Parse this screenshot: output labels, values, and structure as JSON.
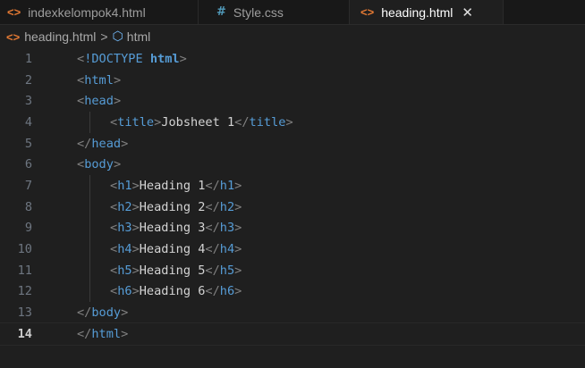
{
  "tabs": [
    {
      "icon": "<>",
      "label": "indexkelompok4.html",
      "type": "html",
      "active": false
    },
    {
      "icon": "#",
      "label": "Style.css",
      "type": "css",
      "active": false
    },
    {
      "icon": "<>",
      "label": "heading.html",
      "type": "html",
      "active": true,
      "close": "✕"
    }
  ],
  "breadcrumb": {
    "file_icon": "<>",
    "file": "heading.html",
    "separator": ">",
    "symbol_icon": "⬡",
    "symbol": "html"
  },
  "editor": {
    "current_line": 14,
    "lines": [
      {
        "n": "1",
        "parts": [
          [
            "<",
            "p"
          ],
          [
            "!DOCTYPE",
            "d"
          ],
          [
            " ",
            "txt"
          ],
          [
            "html",
            "kw"
          ],
          [
            ">",
            "p"
          ]
        ]
      },
      {
        "n": "2",
        "parts": [
          [
            "<",
            "p"
          ],
          [
            "html",
            "t"
          ],
          [
            ">",
            "p"
          ]
        ]
      },
      {
        "n": "3",
        "parts": [
          [
            "<",
            "p"
          ],
          [
            "head",
            "t"
          ],
          [
            ">",
            "p"
          ]
        ]
      },
      {
        "n": "4",
        "parts": [
          [
            "<",
            "p"
          ],
          [
            "title",
            "t"
          ],
          [
            ">",
            "p"
          ],
          [
            "Jobsheet 1",
            "txt"
          ],
          [
            "</",
            "p"
          ],
          [
            "title",
            "t"
          ],
          [
            ">",
            "p"
          ]
        ],
        "indent": true
      },
      {
        "n": "5",
        "parts": [
          [
            "</",
            "p"
          ],
          [
            "head",
            "t"
          ],
          [
            ">",
            "p"
          ]
        ]
      },
      {
        "n": "6",
        "parts": [
          [
            "<",
            "p"
          ],
          [
            "body",
            "t"
          ],
          [
            ">",
            "p"
          ]
        ]
      },
      {
        "n": "7",
        "parts": [
          [
            "<",
            "p"
          ],
          [
            "h1",
            "t"
          ],
          [
            ">",
            "p"
          ],
          [
            "Heading 1",
            "txt"
          ],
          [
            "</",
            "p"
          ],
          [
            "h1",
            "t"
          ],
          [
            ">",
            "p"
          ]
        ],
        "indent": true
      },
      {
        "n": "8",
        "parts": [
          [
            "<",
            "p"
          ],
          [
            "h2",
            "t"
          ],
          [
            ">",
            "p"
          ],
          [
            "Heading 2",
            "txt"
          ],
          [
            "</",
            "p"
          ],
          [
            "h2",
            "t"
          ],
          [
            ">",
            "p"
          ]
        ],
        "indent": true
      },
      {
        "n": "9",
        "parts": [
          [
            "<",
            "p"
          ],
          [
            "h3",
            "t"
          ],
          [
            ">",
            "p"
          ],
          [
            "Heading 3",
            "txt"
          ],
          [
            "</",
            "p"
          ],
          [
            "h3",
            "t"
          ],
          [
            ">",
            "p"
          ]
        ],
        "indent": true
      },
      {
        "n": "10",
        "parts": [
          [
            "<",
            "p"
          ],
          [
            "h4",
            "t"
          ],
          [
            ">",
            "p"
          ],
          [
            "Heading 4",
            "txt"
          ],
          [
            "</",
            "p"
          ],
          [
            "h4",
            "t"
          ],
          [
            ">",
            "p"
          ]
        ],
        "indent": true
      },
      {
        "n": "11",
        "parts": [
          [
            "<",
            "p"
          ],
          [
            "h5",
            "t"
          ],
          [
            ">",
            "p"
          ],
          [
            "Heading 5",
            "txt"
          ],
          [
            "</",
            "p"
          ],
          [
            "h5",
            "t"
          ],
          [
            ">",
            "p"
          ]
        ],
        "indent": true
      },
      {
        "n": "12",
        "parts": [
          [
            "<",
            "p"
          ],
          [
            "h6",
            "t"
          ],
          [
            ">",
            "p"
          ],
          [
            "Heading 6",
            "txt"
          ],
          [
            "</",
            "p"
          ],
          [
            "h6",
            "t"
          ],
          [
            ">",
            "p"
          ]
        ],
        "indent": true
      },
      {
        "n": "13",
        "parts": [
          [
            "</",
            "p"
          ],
          [
            "body",
            "t"
          ],
          [
            ">",
            "p"
          ]
        ]
      },
      {
        "n": "14",
        "parts": [
          [
            "</",
            "p"
          ],
          [
            "html",
            "t"
          ],
          [
            ">",
            "p"
          ]
        ]
      }
    ]
  }
}
